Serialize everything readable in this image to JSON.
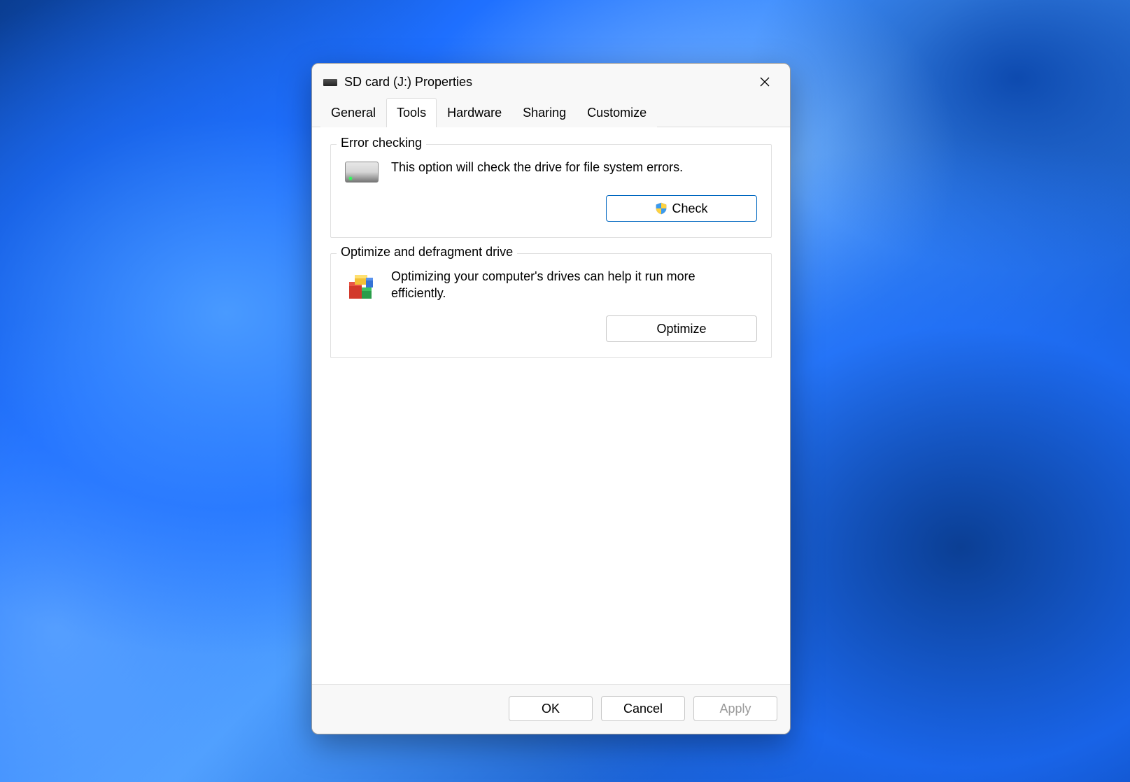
{
  "window": {
    "title": "SD card (J:) Properties"
  },
  "tabs": {
    "general": "General",
    "tools": "Tools",
    "hardware": "Hardware",
    "sharing": "Sharing",
    "customize": "Customize",
    "active": "tools"
  },
  "errorCheck": {
    "title": "Error checking",
    "description": "This option will check the drive for file system errors.",
    "button": "Check"
  },
  "optimize": {
    "title": "Optimize and defragment drive",
    "description": "Optimizing your computer's drives can help it run more efficiently.",
    "button": "Optimize"
  },
  "footer": {
    "ok": "OK",
    "cancel": "Cancel",
    "apply": "Apply"
  }
}
